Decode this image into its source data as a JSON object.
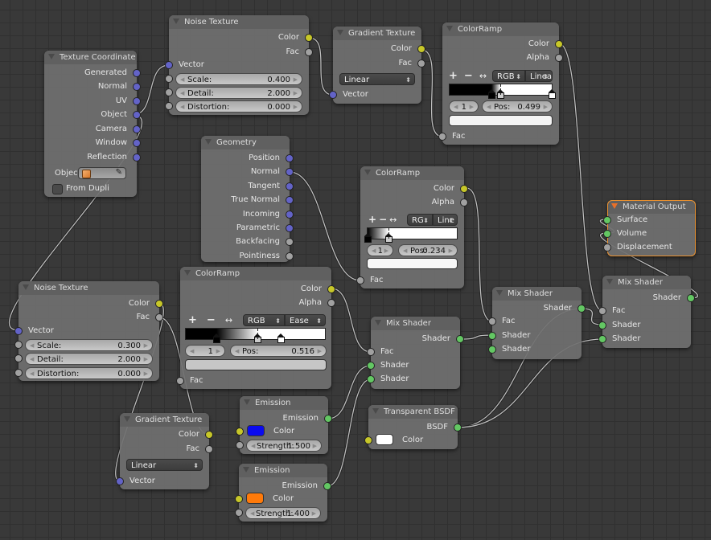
{
  "editor": "Node Editor",
  "nodes": {
    "tex_coord": {
      "title": "Texture Coordinate",
      "outputs": [
        "Generated",
        "Normal",
        "UV",
        "Object",
        "Camera",
        "Window",
        "Reflection"
      ],
      "object_label": "Objec",
      "object_icon": "cube-icon",
      "from_dupli_label": "From Dupli",
      "from_dupli_checked": false
    },
    "noise1": {
      "title": "Noise Texture",
      "outputs": [
        "Color",
        "Fac"
      ],
      "vector_label": "Vector",
      "fields": [
        {
          "label": "Scale:",
          "value": "0.400"
        },
        {
          "label": "Detail:",
          "value": "2.000"
        },
        {
          "label": "Distortion:",
          "value": "0.000"
        }
      ]
    },
    "gradient1": {
      "title": "Gradient Texture",
      "outputs": [
        "Color",
        "Fac"
      ],
      "type_value": "Linear",
      "vector_label": "Vector"
    },
    "ramp1": {
      "title": "ColorRamp",
      "outputs": [
        "Color",
        "Alpha"
      ],
      "color_mode": "RGB",
      "interpolation": "Linea",
      "active_index": "1",
      "pos_label": "Pos:",
      "pos_value": "0.499",
      "stops": [
        0.41,
        0.499,
        1.0
      ],
      "fac_label": "Fac"
    },
    "geometry": {
      "title": "Geometry",
      "outputs": [
        "Position",
        "Normal",
        "Tangent",
        "True Normal",
        "Incoming",
        "Parametric",
        "Backfacing",
        "Pointiness"
      ]
    },
    "ramp2": {
      "title": "ColorRamp",
      "outputs": [
        "Color",
        "Alpha"
      ],
      "color_mode": "RG",
      "interpolation": "Line",
      "active_index": "1",
      "pos_label": "Pos:",
      "pos_value": "0.234",
      "stops": [
        0.0,
        0.234
      ],
      "fac_label": "Fac"
    },
    "material_output": {
      "title": "Material Output",
      "inputs": [
        "Surface",
        "Volume",
        "Displacement"
      ]
    },
    "noise2": {
      "title": "Noise Texture",
      "outputs": [
        "Color",
        "Fac"
      ],
      "vector_label": "Vector",
      "fields": [
        {
          "label": "Scale:",
          "value": "0.300"
        },
        {
          "label": "Detail:",
          "value": "2.000"
        },
        {
          "label": "Distortion:",
          "value": "0.000"
        }
      ]
    },
    "ramp3": {
      "title": "ColorRamp",
      "outputs": [
        "Color",
        "Alpha"
      ],
      "color_mode": "RGB",
      "interpolation": "Ease",
      "active_index": "1",
      "pos_label": "Pos:",
      "pos_value": "0.516",
      "stops": [
        0.22,
        0.516,
        0.68
      ],
      "fac_label": "Fac"
    },
    "mix1": {
      "title": "Mix Shader",
      "output": "Shader",
      "inputs": [
        "Fac",
        "Shader",
        "Shader"
      ]
    },
    "mix2": {
      "title": "Mix Shader",
      "output": "Shader",
      "inputs": [
        "Fac",
        "Shader",
        "Shader"
      ]
    },
    "mix3": {
      "title": "Mix Shader",
      "output": "Shader",
      "inputs": [
        "Fac",
        "Shader",
        "Shader"
      ]
    },
    "gradient2": {
      "title": "Gradient Texture",
      "outputs": [
        "Color",
        "Fac"
      ],
      "type_value": "Linear",
      "vector_label": "Vector"
    },
    "emission1": {
      "title": "Emission",
      "output": "Emission",
      "color_label": "Color",
      "color": "#0a0af0",
      "strength_label": "Strength:",
      "strength_value": "1.500"
    },
    "emission2": {
      "title": "Emission",
      "output": "Emission",
      "color_label": "Color",
      "color": "#ff7a0a",
      "strength_label": "Strength:",
      "strength_value": "1.400"
    },
    "transparent": {
      "title": "Transparent BSDF",
      "output": "BSDF",
      "color_label": "Color",
      "color": "#ffffff"
    }
  },
  "colors": {
    "vector_socket": "#6363c7",
    "color_socket": "#c7c729",
    "value_socket": "#a1a1a1",
    "shader_socket": "#63c763",
    "active_outline": "#e8902f"
  }
}
